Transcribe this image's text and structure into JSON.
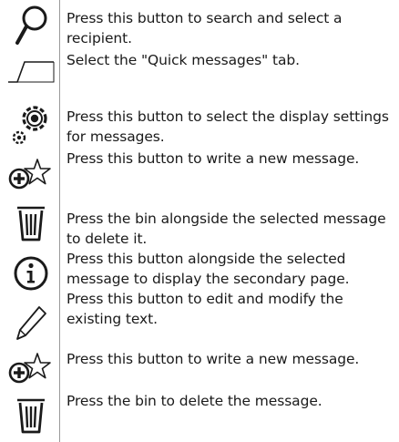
{
  "rows": [
    {
      "icon": "search-icon",
      "text": "Press this button to search and select a recipient."
    },
    {
      "icon": "quick-messages-tab-icon",
      "text": "Select the \"Quick messages\" tab."
    },
    {
      "icon": "settings-gears-icon",
      "text": "Press this button to select the display settings for messages."
    },
    {
      "icon": "new-message-icon",
      "text": "Press this button to write a new message."
    },
    {
      "icon": "bin-icon",
      "text": "Press the bin alongside the selected message to delete it."
    },
    {
      "icon": "info-icon",
      "text": "Press this button alongside the selected message to display the secondary page."
    },
    {
      "icon": "pencil-icon",
      "text": "Press this button to edit and modify the existing text."
    },
    {
      "icon": "new-message-icon",
      "text": "Press this button to write a new message."
    },
    {
      "icon": "bin-icon",
      "text": "Press the bin to delete the message."
    }
  ]
}
